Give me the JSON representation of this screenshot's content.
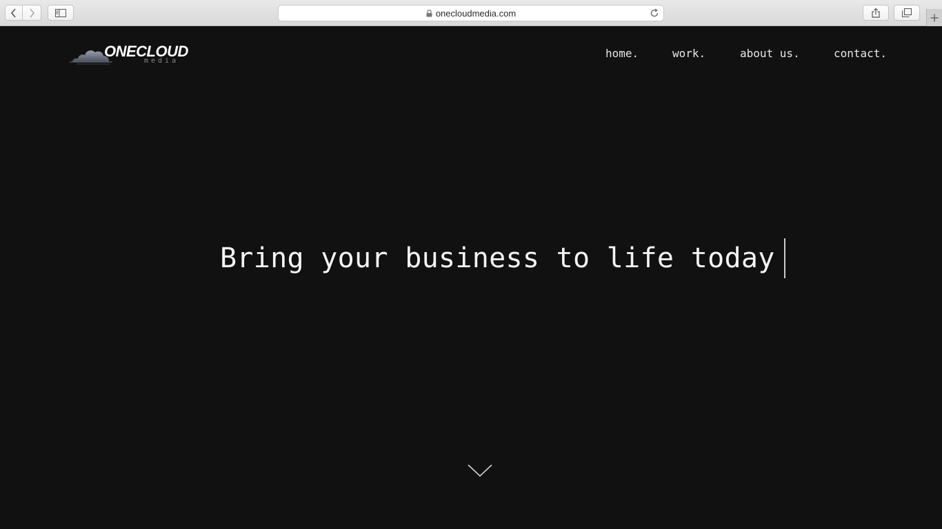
{
  "browser": {
    "url": "onecloudmedia.com",
    "buttons": {
      "back": "chevron-left-icon",
      "forward": "chevron-right-icon",
      "sidebar": "sidebar-icon",
      "reload": "reload-icon",
      "share": "share-icon",
      "tabs": "tabs-icon",
      "new_tab": "plus-icon",
      "lock": "lock-icon"
    }
  },
  "site": {
    "logo": {
      "word": "ONECLOUD",
      "sub": "media"
    },
    "nav": [
      {
        "label": "home."
      },
      {
        "label": "work."
      },
      {
        "label": "about us."
      },
      {
        "label": "contact."
      }
    ],
    "hero": {
      "headline": "Bring your business to life today"
    },
    "scroll_icon": "chevron-down-icon",
    "colors": {
      "background": "#111111",
      "text": "#f4f4f4"
    }
  }
}
